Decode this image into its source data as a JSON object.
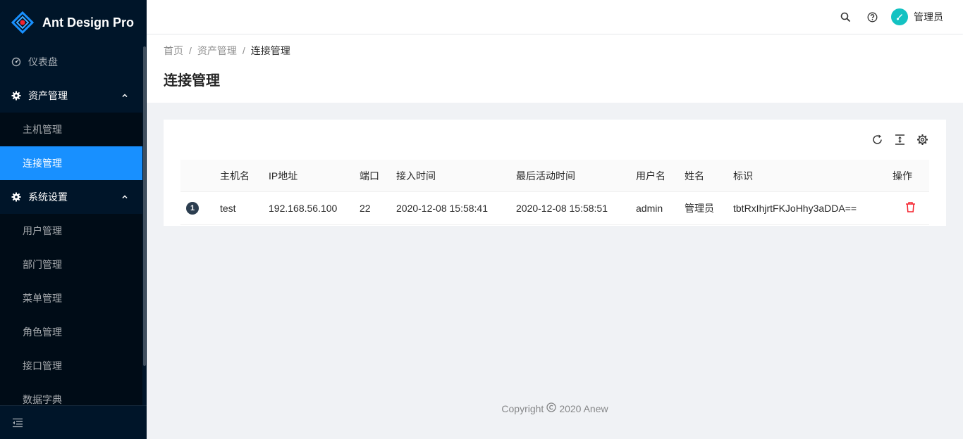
{
  "app": {
    "title": "Ant Design Pro"
  },
  "sidebar": {
    "dashboard": "仪表盘",
    "asset_group": "资产管理",
    "asset_items": [
      "主机管理",
      "连接管理"
    ],
    "system_group": "系统设置",
    "system_items": [
      "用户管理",
      "部门管理",
      "菜单管理",
      "角色管理",
      "接口管理",
      "数据字典"
    ],
    "active_item": "连接管理"
  },
  "header": {
    "user_name": "管理员"
  },
  "breadcrumb": {
    "home": "首页",
    "parent": "资产管理",
    "current": "连接管理"
  },
  "page": {
    "title": "连接管理"
  },
  "table": {
    "columns": [
      "主机名",
      "IP地址",
      "端口",
      "接入时间",
      "最后活动时间",
      "用户名",
      "姓名",
      "标识",
      "操作"
    ],
    "rows": [
      {
        "index": "1",
        "host": "test",
        "ip": "192.168.56.100",
        "port": "22",
        "connect_time": "2020-12-08 15:58:41",
        "last_active": "2020-12-08 15:58:51",
        "username": "admin",
        "name": "管理员",
        "token": "tbtRxIhjrtFKJoHhy3aDDA=="
      }
    ]
  },
  "footer": {
    "prefix": "Copyright",
    "suffix": "2020 Anew"
  },
  "colors": {
    "sider": "#001529",
    "primary": "#1890ff",
    "danger": "#f5222d",
    "avatar": "#13c2c2"
  }
}
